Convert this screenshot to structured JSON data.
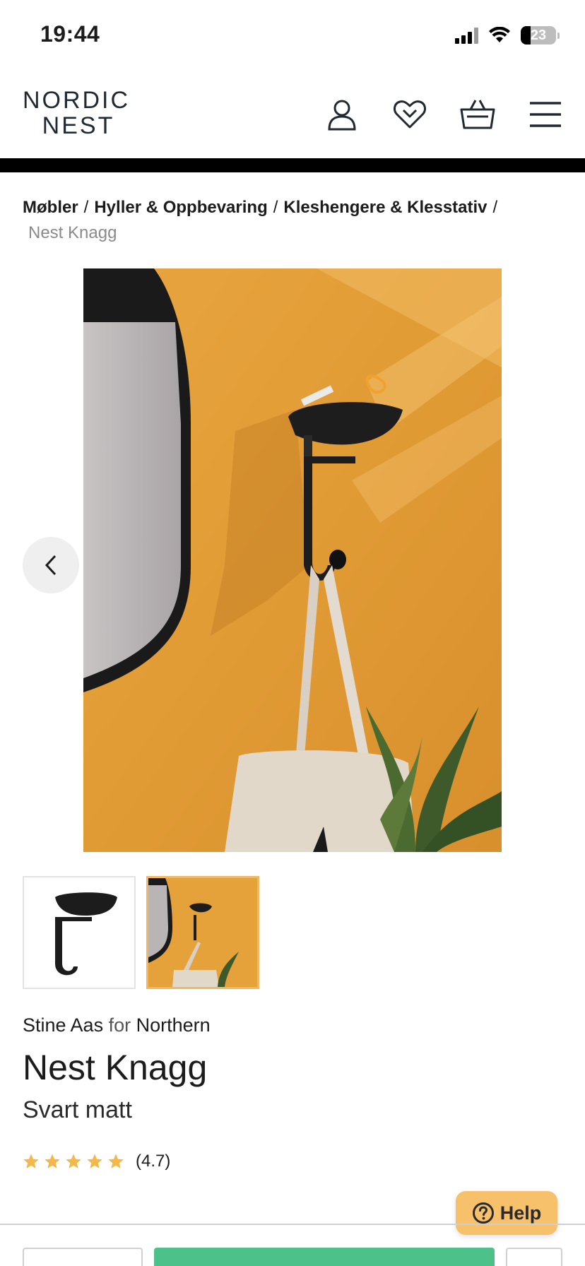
{
  "status_bar": {
    "time": "19:44",
    "battery": "23"
  },
  "header": {
    "logo_line1": "NORDIC",
    "logo_line2": "NEST",
    "icons": [
      "account-icon",
      "wishlist-heart-icon",
      "basket-icon",
      "menu-icon"
    ]
  },
  "breadcrumb": {
    "items": [
      "Møbler",
      "Hyller & Oppbevaring",
      "Kleshengere & Klesstativ"
    ],
    "separator": "/",
    "current": "Nest Knagg"
  },
  "product": {
    "designer": "Stine Aas",
    "for_word": "for",
    "brand": "Northern",
    "title": "Nest Knagg",
    "variant": "Svart matt",
    "rating_stars": 5,
    "rating_value": "(4.7)"
  },
  "help_button": {
    "label": "Help"
  },
  "colors": {
    "accent_buy": "#4cc28a",
    "help_bg": "#f7c06a",
    "star": "#f4b74a",
    "thumb_selected_border": "#f0b860"
  }
}
